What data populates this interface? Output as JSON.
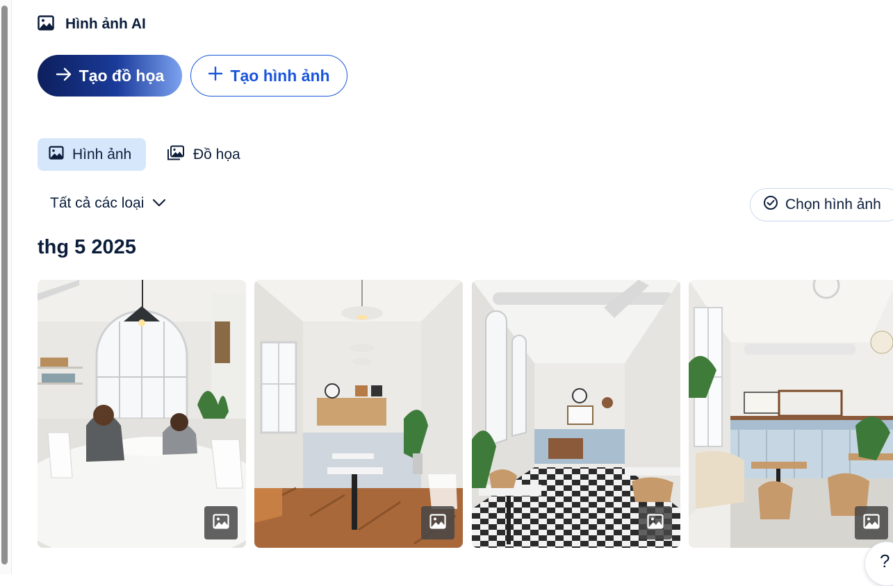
{
  "header": {
    "title": "Hình ảnh AI",
    "icon": "image-icon"
  },
  "actions": {
    "create_graphic_label": "Tạo đồ họa",
    "create_image_label": "Tạo hình ảnh"
  },
  "tabs": [
    {
      "label": "Hình ảnh",
      "icon": "image-icon",
      "active": true
    },
    {
      "label": "Đồ họa",
      "icon": "graphics-stack-icon",
      "active": false
    }
  ],
  "filter": {
    "selected": "Tất cả các loại"
  },
  "select_images_label": "Chọn hình ảnh",
  "section_title": "thg 5 2025",
  "images": [
    {
      "scene": "cafe-round-window-two-people",
      "badge_icon": "image-icon"
    },
    {
      "scene": "cafe-corridor-herringbone",
      "badge_icon": "image-icon"
    },
    {
      "scene": "cafe-checkered-floor",
      "badge_icon": "image-icon"
    },
    {
      "scene": "cafe-bright-kitchen",
      "badge_icon": "image-icon"
    }
  ],
  "help_label": "?",
  "colors": {
    "accent": "#1a56db",
    "primary_dark": "#0d1f5c",
    "active_tab": "#d6e7fb",
    "text": "#0b1d3a"
  }
}
